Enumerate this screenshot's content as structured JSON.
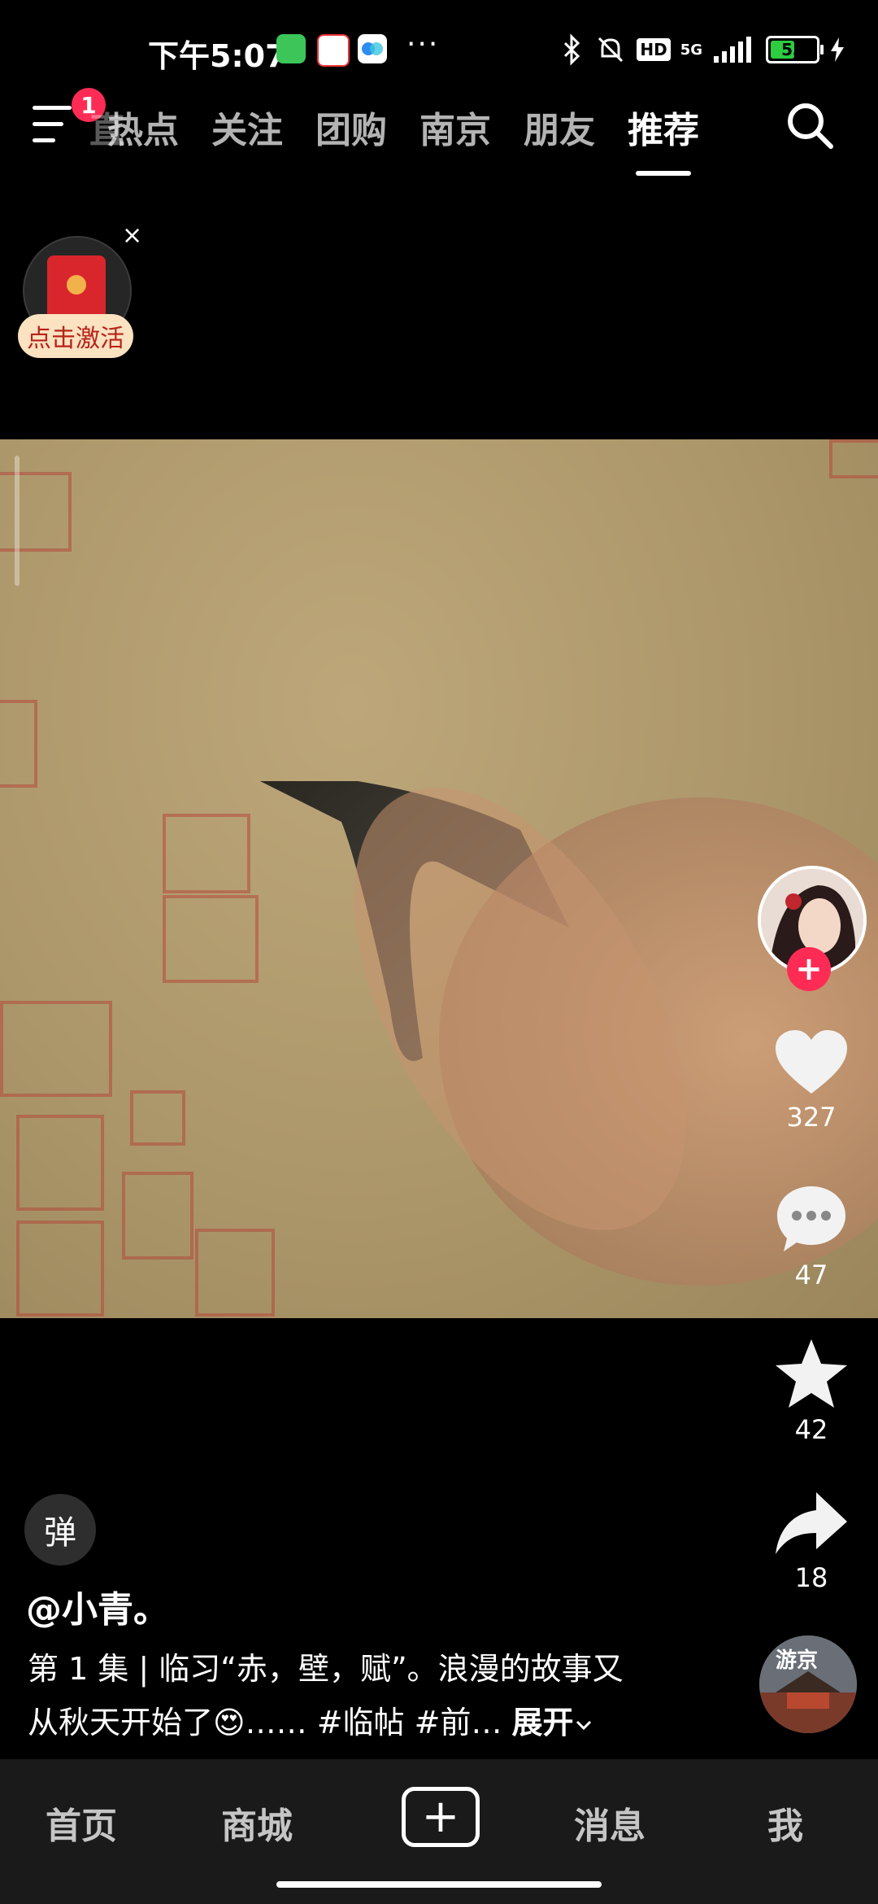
{
  "status_bar": {
    "time": "下午5:07",
    "network": "5G",
    "hd_label": "HD",
    "battery_level": "53",
    "battery_fraction": 0.53,
    "more": "···"
  },
  "top_nav": {
    "notification_count": "1",
    "partial_tab": "直",
    "tabs": [
      {
        "label": "热点"
      },
      {
        "label": "关注"
      },
      {
        "label": "团购"
      },
      {
        "label": "南京"
      },
      {
        "label": "朋友"
      },
      {
        "label": "推荐"
      }
    ],
    "active_tab": "推荐"
  },
  "red_packet": {
    "label": "点击激活",
    "close": "×"
  },
  "actions": {
    "like_count": "327",
    "comment_count": "47",
    "favorite_count": "42",
    "share_count": "18",
    "follow": "+"
  },
  "post": {
    "danmu_label": "弹",
    "author": "@小青。",
    "desc_line1": "第 1 集 | 临习“赤，壁，赋”。浪漫的故事又",
    "desc_line2": "从秋天开始了😍…… #临帖 #前…",
    "expand": "展开",
    "music_disc_text": "游京"
  },
  "bottom_nav": {
    "items": [
      {
        "label": "首页"
      },
      {
        "label": "商城"
      },
      {
        "label": "+"
      },
      {
        "label": "消息"
      },
      {
        "label": "我"
      }
    ]
  },
  "colors": {
    "accent": "#fe2c55",
    "background": "#000000",
    "seal_red": "#b4483d"
  }
}
